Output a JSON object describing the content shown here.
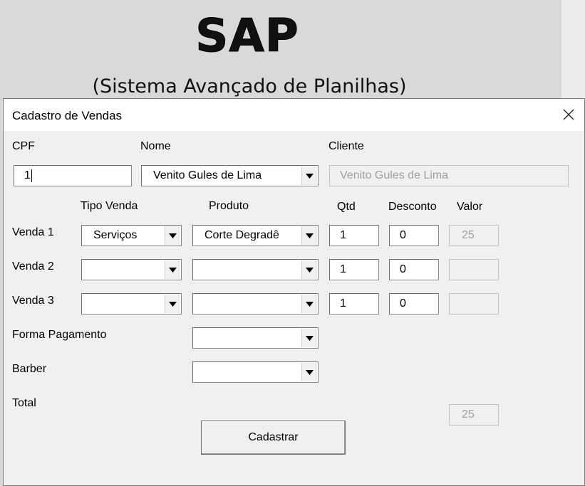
{
  "background": {
    "logo_title": "SAP",
    "logo_subtitle": "(Sistema Avançado de Planilhas)"
  },
  "dialog": {
    "title": "Cadastro de Vendas",
    "close_icon": "close-icon",
    "labels": {
      "cpf": "CPF",
      "nome": "Nome",
      "cliente": "Cliente",
      "tipo_venda": "Tipo Venda",
      "produto": "Produto",
      "qtd": "Qtd",
      "desconto": "Desconto",
      "valor": "Valor",
      "venda1": "Venda 1",
      "venda2": "Venda 2",
      "venda3": "Venda 3",
      "forma_pagamento": "Forma Pagamento",
      "barber": "Barber",
      "total": "Total"
    },
    "cpf_value": "1",
    "nome_value": "Venito Gules de Lima",
    "cliente_value": "Venito Gules de Lima",
    "vendas": [
      {
        "tipo": "Serviços",
        "produto": "Corte Degradê",
        "qtd": "1",
        "desconto": "0",
        "valor": "25"
      },
      {
        "tipo": "",
        "produto": "",
        "qtd": "1",
        "desconto": "0",
        "valor": ""
      },
      {
        "tipo": "",
        "produto": "",
        "qtd": "1",
        "desconto": "0",
        "valor": ""
      }
    ],
    "forma_pagamento_value": "",
    "barber_value": "",
    "total_value": "25",
    "submit_label": "Cadastrar"
  }
}
